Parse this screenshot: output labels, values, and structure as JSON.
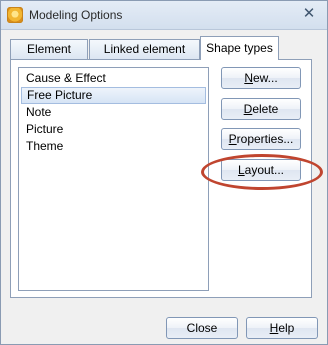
{
  "window": {
    "title": "Modeling Options",
    "close_glyph": "✕",
    "app_icon": "modeling-app-icon"
  },
  "tabs": [
    {
      "label": "Element types",
      "active": false
    },
    {
      "label": "Linked element types",
      "active": false
    },
    {
      "label": "Shape types",
      "active": true
    }
  ],
  "shape_types": {
    "items": [
      {
        "label": "Cause & Effect",
        "selected": false
      },
      {
        "label": "Free Picture",
        "selected": true
      },
      {
        "label": "Note",
        "selected": false
      },
      {
        "label": "Picture",
        "selected": false
      },
      {
        "label": "Theme",
        "selected": false
      }
    ]
  },
  "buttons": {
    "new": {
      "mnemonic": "N",
      "rest": "ew..."
    },
    "delete": {
      "mnemonic": "D",
      "rest": "elete"
    },
    "properties": {
      "mnemonic": "P",
      "rest": "roperties..."
    },
    "layout": {
      "mnemonic": "L",
      "rest": "ayout..."
    }
  },
  "footer": {
    "close": {
      "label": "Close"
    },
    "help": {
      "mnemonic": "H",
      "rest": "elp"
    }
  },
  "annotation": {
    "color": "#c0452f"
  }
}
